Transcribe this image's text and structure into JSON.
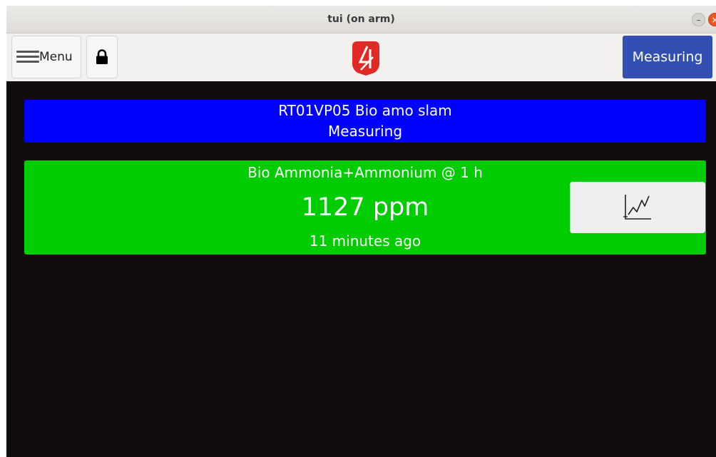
{
  "window": {
    "title": "tui (on arm)",
    "controls": {
      "minimize_glyph": "–",
      "close_glyph": "×"
    }
  },
  "toolbar": {
    "menu_label": "Menu",
    "menu_icon": "hamburger-icon",
    "lock_icon": "lock-icon",
    "logo_icon": "brand-logo",
    "status_button_label": "Measuring",
    "status_button_color": "#3250b4"
  },
  "device": {
    "name": "RT01VP05 Bio amo slam",
    "state": "Measuring",
    "banner_color": "#0000ff"
  },
  "reading": {
    "parameter": "Bio Ammonia+Ammonium @ 1 h",
    "value": "1127 ppm",
    "age": "11 minutes ago",
    "card_color": "#00cc00",
    "chart_button_icon": "trend-chart-icon"
  }
}
